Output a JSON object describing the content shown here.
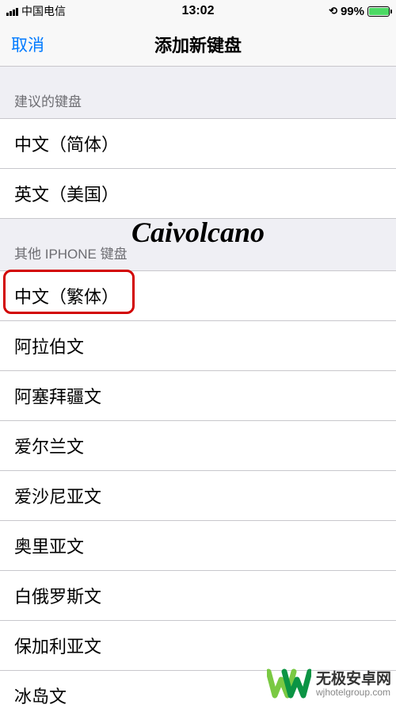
{
  "statusBar": {
    "carrier": "中国电信",
    "time": "13:02",
    "batteryPct": "99%"
  },
  "nav": {
    "cancel": "取消",
    "title": "添加新键盘"
  },
  "sections": {
    "suggested": {
      "header": "建议的键盘",
      "items": [
        "中文（简体）",
        "英文（美国）"
      ]
    },
    "other": {
      "header": "其他 IPHONE 键盘",
      "items": [
        "中文（繁体）",
        "阿拉伯文",
        "阿塞拜疆文",
        "爱尔兰文",
        "爱沙尼亚文",
        "奥里亚文",
        "白俄罗斯文",
        "保加利亚文",
        "冰岛文"
      ]
    }
  },
  "highlightIndex": 0,
  "watermark": {
    "script": "Caivolcano",
    "logoCn": "无极安卓网",
    "logoUrl": "wjhotelgroup.com"
  }
}
